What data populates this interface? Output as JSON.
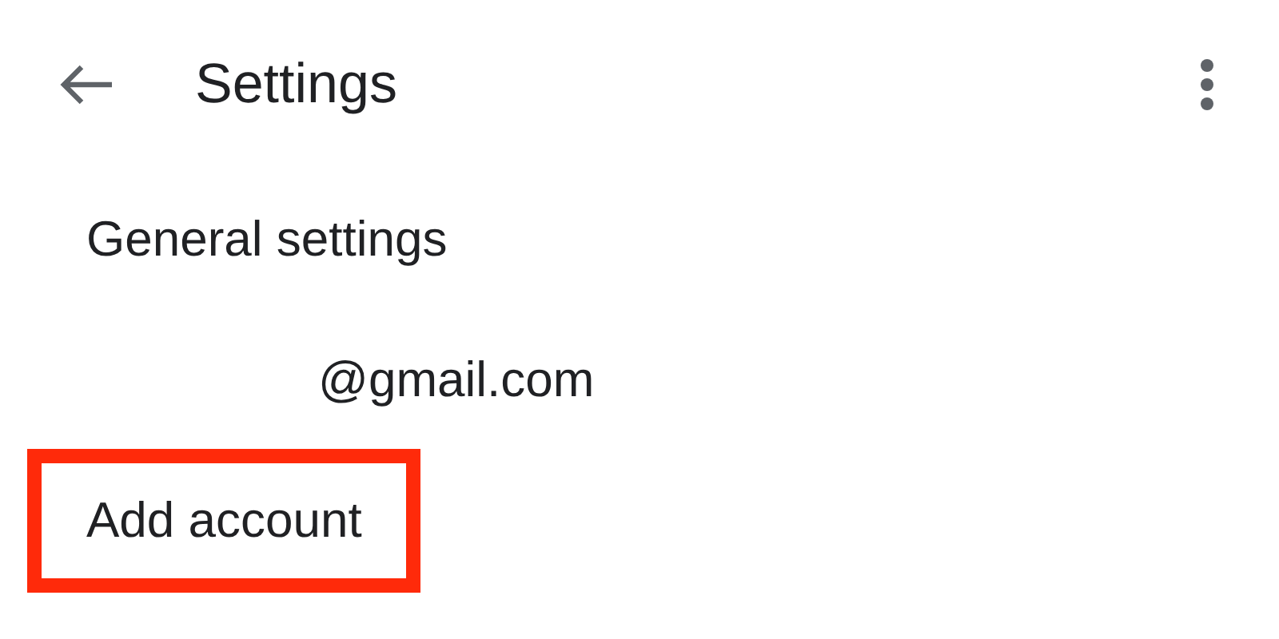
{
  "header": {
    "title": "Settings"
  },
  "items": [
    {
      "kind": "plain",
      "label": "General settings",
      "highlighted": false
    },
    {
      "kind": "account",
      "label": "@gmail.com",
      "highlighted": false
    },
    {
      "kind": "plain",
      "label": "Add account",
      "highlighted": true
    }
  ]
}
